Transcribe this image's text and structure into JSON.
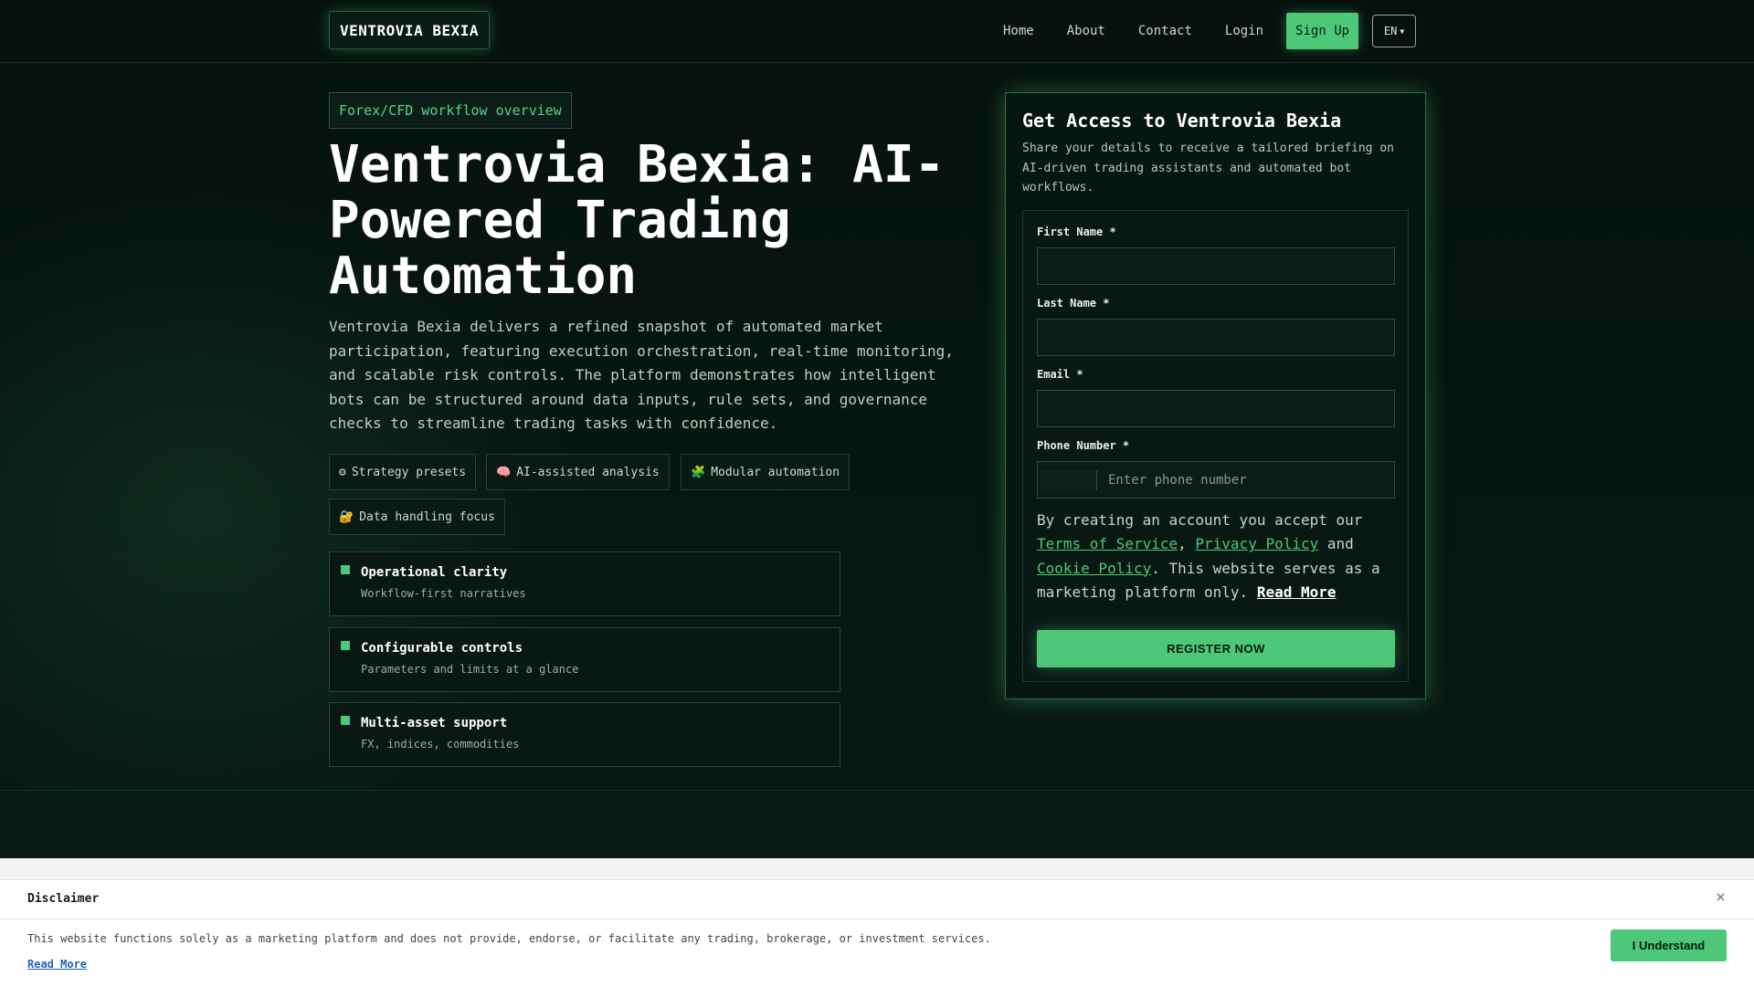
{
  "header": {
    "logo": "VENTROVIA BEXIA",
    "nav": [
      "Home",
      "About",
      "Contact",
      "Login"
    ],
    "signup_label": "Sign Up",
    "language": "EN",
    "language_icon": "chevron-down-icon"
  },
  "hero": {
    "tag": "Forex/CFD workflow overview",
    "title": "Ventrovia Bexia: AI-Powered Trading Automation",
    "description": "Ventrovia Bexia delivers a refined snapshot of automated market participation, featuring execution orchestration, real-time monitoring, and scalable risk controls. The platform demonstrates how intelligent bots can be structured around data inputs, rule sets, and governance checks to streamline trading tasks with confidence.",
    "chips": [
      {
        "icon": "⚙",
        "icon_name": "gear-icon",
        "label": "Strategy presets"
      },
      {
        "icon": "🧠",
        "icon_name": "brain-icon",
        "label": "AI-assisted analysis"
      },
      {
        "icon": "🧩",
        "icon_name": "puzzle-icon",
        "label": "Modular automation"
      },
      {
        "icon": "🔐",
        "icon_name": "lock-icon",
        "label": "Data handling focus"
      }
    ],
    "features": [
      {
        "title": "Operational clarity",
        "subtitle": "Workflow-first narratives"
      },
      {
        "title": "Configurable controls",
        "subtitle": "Parameters and limits at a glance"
      },
      {
        "title": "Multi-asset support",
        "subtitle": "FX, indices, commodities"
      }
    ]
  },
  "form": {
    "title": "Get Access to Ventrovia Bexia",
    "subtitle": "Share your details to receive a tailored briefing on AI-driven trading assistants and automated bot workflows.",
    "first_name_label": "First Name *",
    "first_name_value": "",
    "last_name_label": "Last Name *",
    "last_name_value": "",
    "email_label": "Email *",
    "email_value": "",
    "phone_label": "Phone Number *",
    "phone_placeholder": "Enter phone number",
    "terms_prefix": "By creating an account you accept our ",
    "terms_link": "Terms of Service",
    "terms_sep": ", ",
    "privacy_link": "Privacy Policy",
    "terms_and": " and ",
    "cookie_link": "Cookie Policy",
    "terms_suffix": ". This website serves as a marketing platform only. ",
    "read_more": "Read More",
    "register_label": "REGISTER NOW"
  },
  "disclaimer": {
    "title": "Disclaimer",
    "close": "×",
    "text": "This website functions solely as a marketing platform and does not provide, endorse, or facilitate any trading, brokerage, or investment services.",
    "read_more": "Read More",
    "button": "I Understand"
  },
  "colors": {
    "accent": "#4cc878",
    "background": "#071410",
    "card_border": "#2d6a4b"
  }
}
